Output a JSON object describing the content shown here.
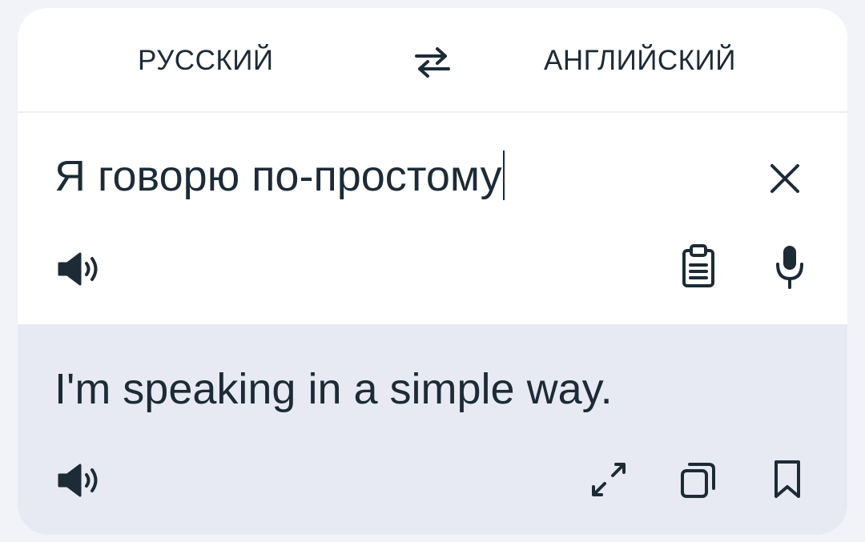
{
  "languages": {
    "source": "РУССКИЙ",
    "target": "АНГЛИЙСКИЙ"
  },
  "input": {
    "text": "Я говорю по-простому"
  },
  "output": {
    "text": "I'm speaking in a simple way."
  },
  "icons": {
    "swap": "swap-icon",
    "clear": "close-icon",
    "speaker": "speaker-icon",
    "paste": "clipboard-icon",
    "mic": "microphone-icon",
    "expand": "expand-icon",
    "copy": "copy-icon",
    "bookmark": "bookmark-icon"
  },
  "colors": {
    "text": "#1c2b36",
    "card": "#ffffff",
    "output_bg": "#e7eaf3",
    "page_bg": "#f1f3f8"
  }
}
